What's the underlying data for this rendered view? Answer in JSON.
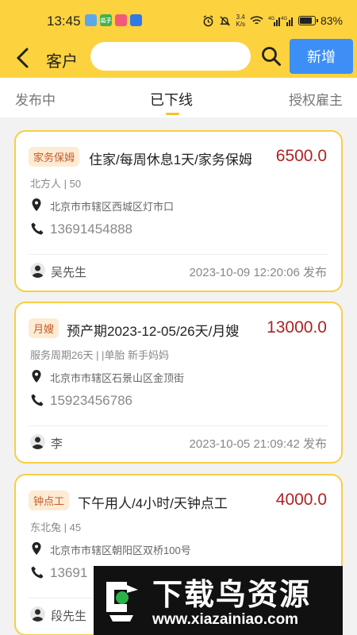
{
  "status_bar": {
    "time": "13:45",
    "apps": [
      {
        "name": "app-blue-icon",
        "label": "",
        "color": "#5aa7ee"
      },
      {
        "name": "app-green-icon",
        "label": "瓜子",
        "color": "#3fb34f"
      },
      {
        "name": "app-pink-icon",
        "label": "",
        "color": "#f2597a"
      },
      {
        "name": "app-messenger-icon",
        "label": "",
        "color": "#2f79e8"
      }
    ],
    "speed_top": "3.4",
    "speed_bottom": "K/s",
    "battery": "83%",
    "battery_level": 0.83
  },
  "header": {
    "title": "客户",
    "search_placeholder": "",
    "add_label": "新增"
  },
  "tabs": [
    {
      "label": "发布中"
    },
    {
      "label": "已下线"
    },
    {
      "label": "授权雇主"
    }
  ],
  "cards": [
    {
      "tag": "家务保姆",
      "title": "住家/每周休息1天/家务保姆",
      "price": "6500.0",
      "meta": "北方人 | 50",
      "address": "北京市市辖区西城区灯市口",
      "phone": "13691454888",
      "user": "吴先生",
      "time": "2023-10-09 12:20:06 发布"
    },
    {
      "tag": "月嫂",
      "title": "预产期2023-12-05/26天/月嫂",
      "price": "13000.0",
      "meta": "服务周期26天 | |单胎 新手妈妈",
      "address": "北京市市辖区石景山区金顶街",
      "phone": "15923456786",
      "user": "李",
      "time": "2023-10-05 21:09:42 发布"
    },
    {
      "tag": "钟点工",
      "title": "下午用人/4小时/天钟点工",
      "price": "4000.0",
      "meta": "东北兔 | 45",
      "address": "北京市市辖区朝阳区双桥100号",
      "phone": "13691",
      "user": "段先生",
      "time": ""
    }
  ],
  "watermark": {
    "brand": "下载鸟资源",
    "url": "www.xiazainiao.com"
  },
  "colors": {
    "accent": "#fdd23f",
    "price": "#b02223",
    "button": "#3d8ff7"
  }
}
